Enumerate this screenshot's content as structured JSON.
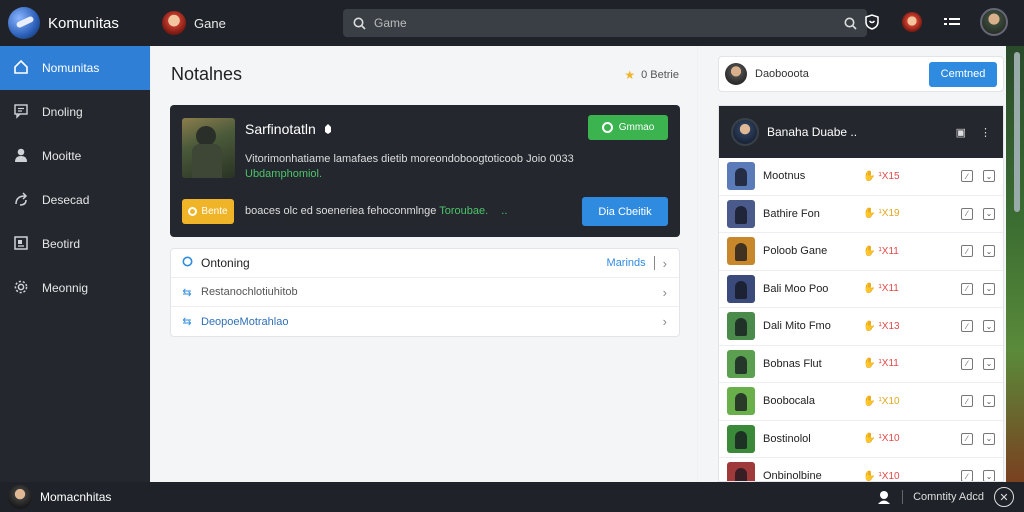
{
  "app": {
    "title": "Komunitas"
  },
  "game_tab": {
    "label": "Gane"
  },
  "search": {
    "placeholder": "Game"
  },
  "sidebar": {
    "items": [
      {
        "label": "Nomunitas",
        "icon": "home-icon",
        "active": true
      },
      {
        "label": "Dnoling",
        "icon": "message-icon",
        "active": false
      },
      {
        "label": "Mooitte",
        "icon": "user-icon",
        "active": false
      },
      {
        "label": "Desecad",
        "icon": "arrows-icon",
        "active": false
      },
      {
        "label": "Beotird",
        "icon": "board-icon",
        "active": false
      },
      {
        "label": "Meonnig",
        "icon": "gear-icon",
        "active": false
      }
    ]
  },
  "main": {
    "title": "Notalnes",
    "status": "0 Betrie",
    "feature": {
      "title": "Sarfinotatln",
      "description": "Vitorimonhatiame lamafaes dietib moreondoboogtoticoob Joio 0033",
      "description_link": "Ubdamphomiol.",
      "primary_button": "Gmmao",
      "secondary_button": "Bente",
      "note": "boaces olc ed soeneriea fehoconmlnge",
      "note_link": "Toroubae.",
      "note_dots": "..",
      "cta_button": "Dia Cbeitik"
    },
    "list": [
      {
        "label": "Ontoning",
        "link": "Marinds",
        "icon": "circle-icon",
        "type": "header"
      },
      {
        "label": "Restanochlotiuhitob",
        "icon": "swap-icon",
        "type": "sub"
      },
      {
        "label": "DeopoeMotrahlao",
        "icon": "swap-icon",
        "type": "sub-blue"
      }
    ]
  },
  "right_panel": {
    "card_label": "Daobooota",
    "card_button": "Cemtned",
    "players_title": "Banaha Duabe ..",
    "players": [
      {
        "name": "Mootnus",
        "score": "¹X15",
        "color": "red",
        "thumb": "#5a7ab8"
      },
      {
        "name": "Bathire Fon",
        "score": "¹X19",
        "color": "yellow",
        "thumb": "#4a5a8a"
      },
      {
        "name": "Poloob Gane",
        "score": "¹X11",
        "color": "red",
        "thumb": "#c8872a"
      },
      {
        "name": "Bali Moo Poo",
        "score": "¹X11",
        "color": "red",
        "thumb": "#3a4a7a"
      },
      {
        "name": "Dali Mito Fmo",
        "score": "¹X13",
        "color": "red",
        "thumb": "#4a8a4a"
      },
      {
        "name": "Bobnas Flut",
        "score": "¹X11",
        "color": "red",
        "thumb": "#5aa050"
      },
      {
        "name": "Boobocala",
        "score": "¹X10",
        "color": "yellow",
        "thumb": "#6ab04a"
      },
      {
        "name": "Bostinolol",
        "score": "¹X10",
        "color": "red",
        "thumb": "#3a8a3a"
      },
      {
        "name": "Onbinolbine",
        "score": "¹X10",
        "color": "red",
        "thumb": "#a03a3a"
      }
    ]
  },
  "bottom": {
    "user": "Momacnhitas",
    "right_label": "Comntity Adcd"
  },
  "colors": {
    "accent": "#2f8be0",
    "success": "#3bb34f",
    "warning": "#f0b428",
    "dark": "#1f2329"
  }
}
